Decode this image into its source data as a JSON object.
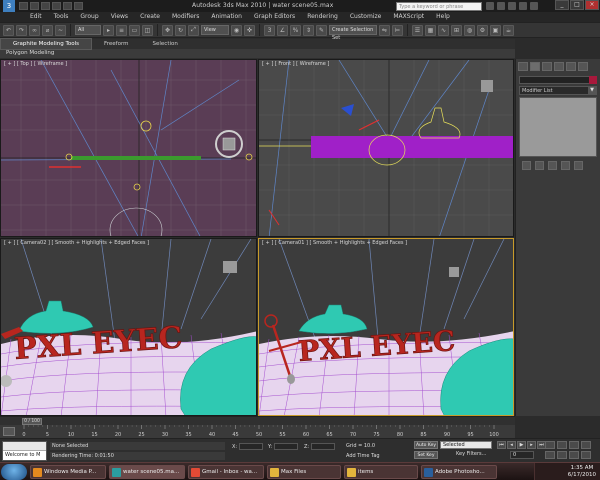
{
  "window": {
    "title": "Autodesk 3ds Max 2010  |  water scene05.max",
    "search_placeholder": "Type a keyword or phrase"
  },
  "menu": [
    "Edit",
    "Tools",
    "Group",
    "Views",
    "Create",
    "Modifiers",
    "Animation",
    "Graph Editors",
    "Rendering",
    "Customize",
    "MAXScript",
    "Help"
  ],
  "toolbar": {
    "selection_filter": "All",
    "reference_coord": "View",
    "named_sets": "Create Selection Set"
  },
  "ribbon": {
    "tabs": [
      "Graphite Modeling Tools",
      "Freeform",
      "Selection"
    ],
    "active_tab": 0,
    "subpanel": "Polygon Modeling"
  },
  "viewports": {
    "top_label": "[ + ] [ Top ] [ Wireframe ]",
    "front_label": "[ + ] [ Front ] [ Wireframe ]",
    "cam02_label": "[ + ] [ Camera02 ] [ Smooth + Highlights + Edged Faces ]",
    "cam01_label": "[ + ] [ Camera01 ] [ Smooth + Highlights + Edged Faces ]",
    "scene_text": "PXL EYEC",
    "scene_text_color": "#b8261f",
    "wire_color": "#b25ad1",
    "bottle_color": "#2fc9b2",
    "active_border": "#c89b2a"
  },
  "command_panel": {
    "modifier_list": "Modifier List",
    "object_color": "#a8193c"
  },
  "timeline": {
    "current": "0 / 100",
    "tick_labels": [
      "0",
      "5",
      "10",
      "15",
      "20",
      "25",
      "30",
      "35",
      "40",
      "45",
      "50",
      "55",
      "60",
      "65",
      "70",
      "75",
      "80",
      "85",
      "90",
      "95",
      "100"
    ]
  },
  "status": {
    "maxscript_text": "Welcome to M",
    "prompt_line1": "None Selected",
    "prompt_line2": "Rendering Time: 0:01:50",
    "x_label": "X:",
    "y_label": "Y:",
    "z_label": "Z:",
    "grid": "Grid = 10.0",
    "add_time_tag": "Add Time Tag",
    "auto_key": "Auto Key",
    "set_key": "Set Key",
    "selected": "Selected",
    "key_filters": "Key Filters...",
    "frame": "0"
  },
  "taskbar": {
    "items": [
      {
        "label": "Windows Media P...",
        "color": "#e58a1f"
      },
      {
        "label": "water scene05.ma...",
        "color": "#2a9ea0"
      },
      {
        "label": "Gmail - Inbox - wa...",
        "color": "#e24a35"
      },
      {
        "label": "Max Files",
        "color": "#e3b53c"
      },
      {
        "label": "items",
        "color": "#e3b53c"
      },
      {
        "label": "Adobe Photosho...",
        "color": "#2a5f9c"
      }
    ],
    "active_index": 1,
    "time": "1:35 AM",
    "date": "6/17/2010"
  }
}
